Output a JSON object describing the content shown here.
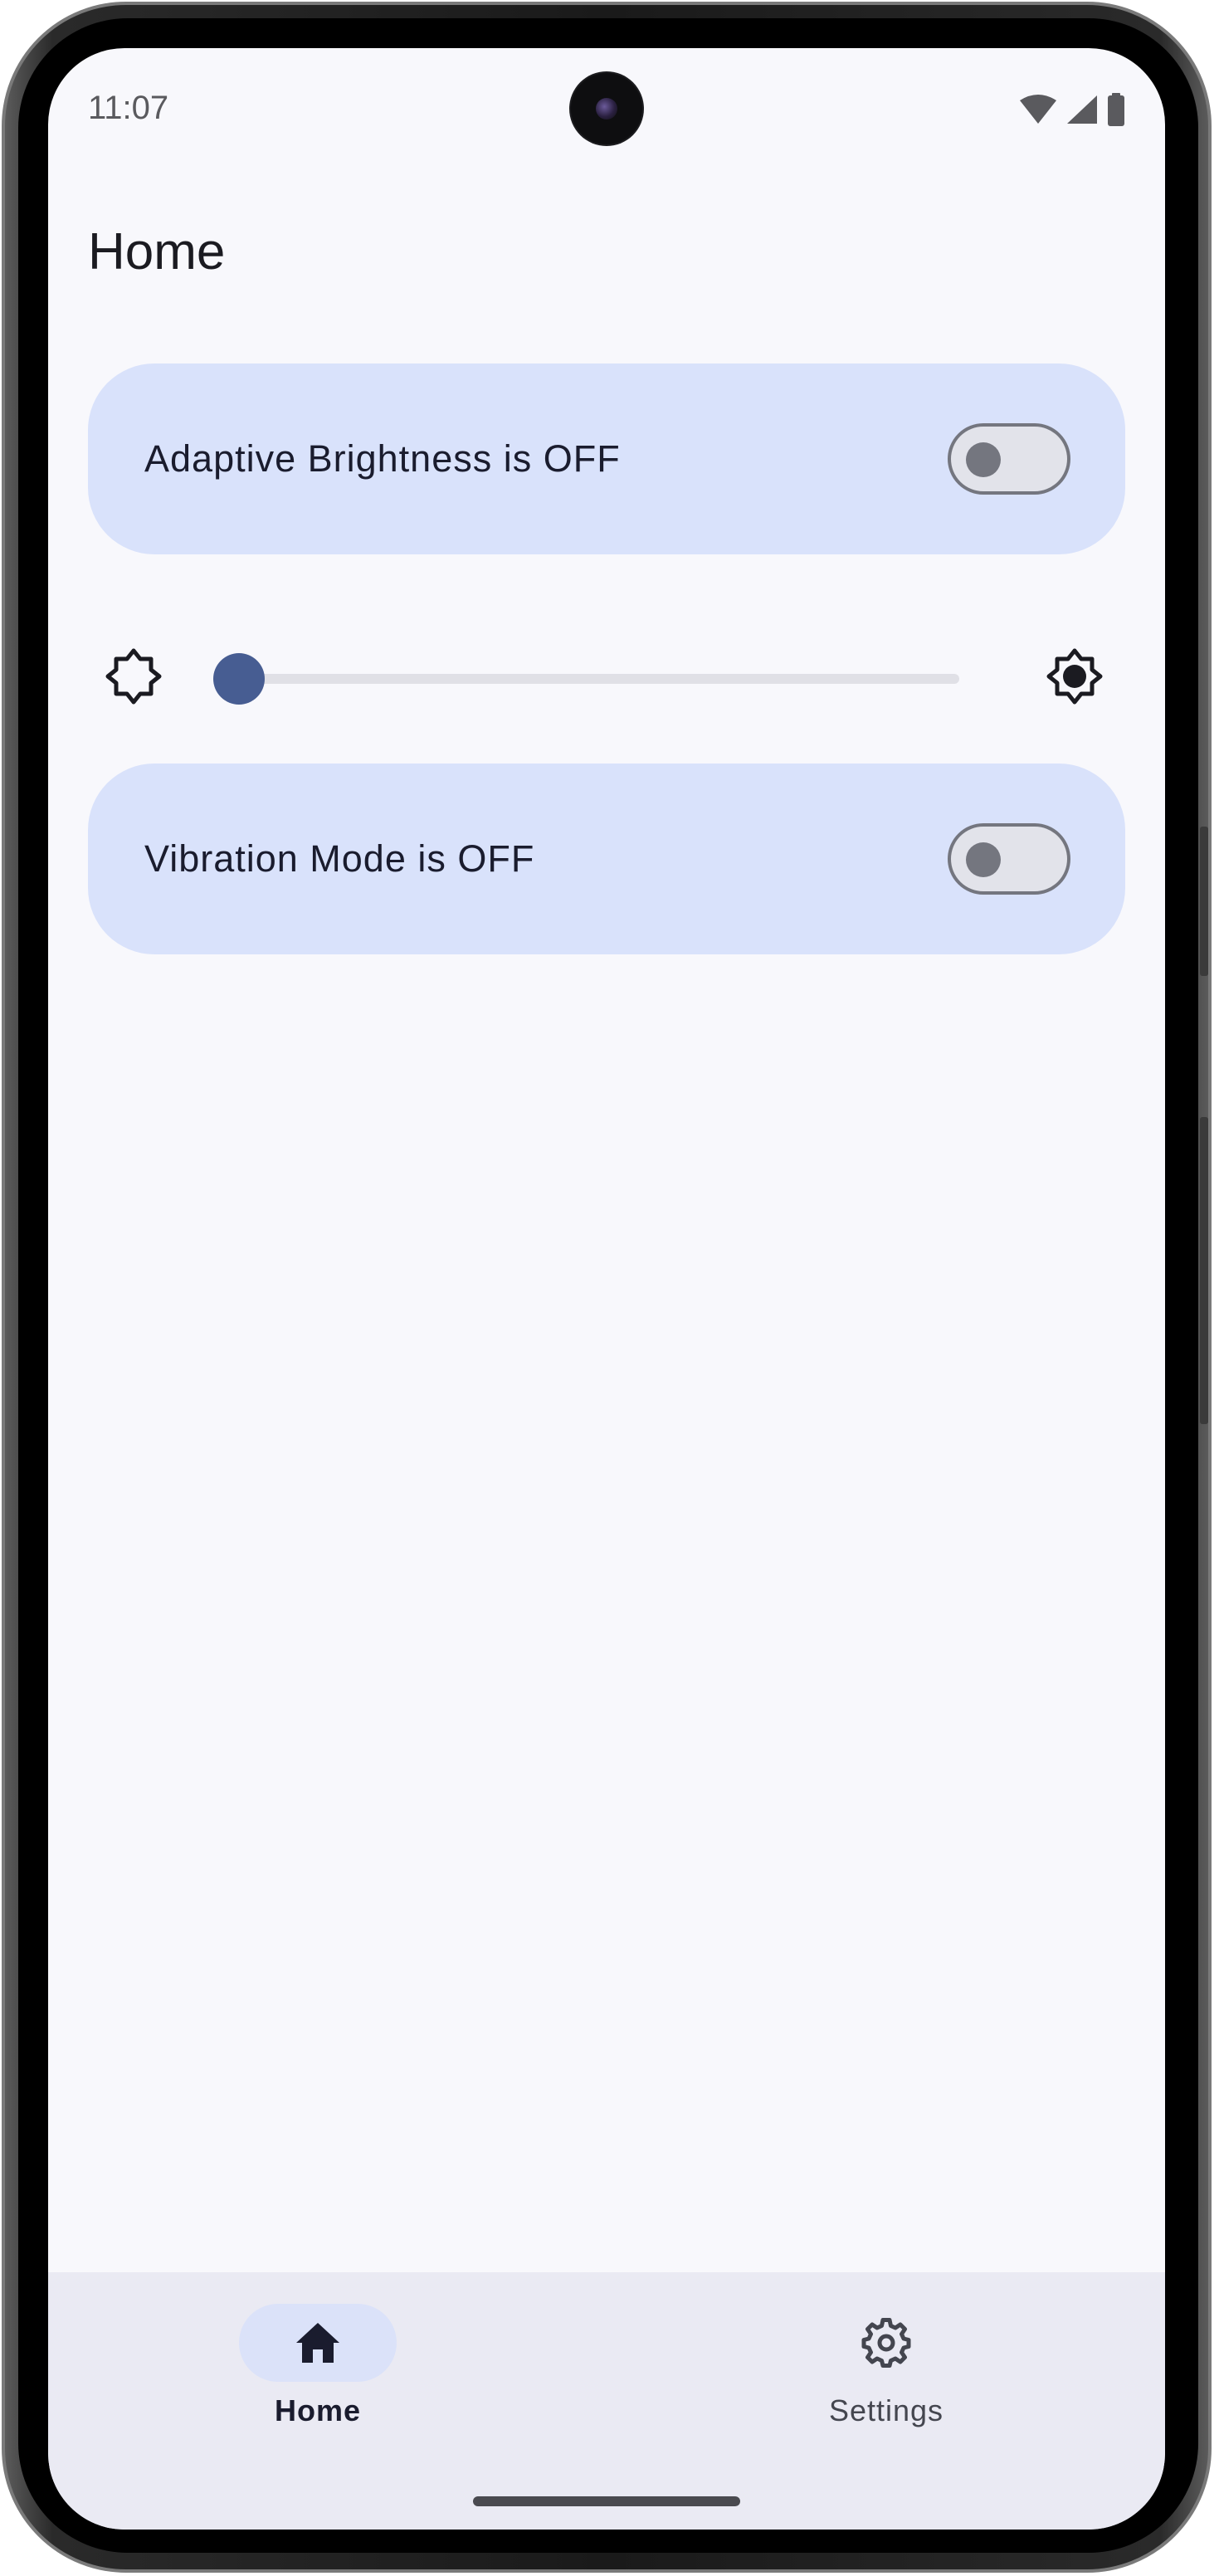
{
  "status_bar": {
    "time": "11:07",
    "icons": [
      "wifi-icon",
      "cellular-signal-icon",
      "battery-icon"
    ]
  },
  "header": {
    "title": "Home"
  },
  "settings": {
    "adaptive_brightness": {
      "label": "Adaptive Brightness is OFF",
      "enabled": false
    },
    "brightness_slider": {
      "value": 0.03,
      "min_icon": "brightness-low-icon",
      "max_icon": "brightness-high-icon"
    },
    "vibration_mode": {
      "label": "Vibration Mode is OFF",
      "enabled": false
    }
  },
  "bottom_nav": {
    "items": [
      {
        "label": "Home",
        "icon": "home-icon",
        "selected": true
      },
      {
        "label": "Settings",
        "icon": "settings-gear-icon",
        "selected": false
      }
    ]
  },
  "colors": {
    "screen_background": "#f8f8fc",
    "card_background": "#d9e2fb",
    "accent": "#475d92",
    "nav_background": "#eaeaf3",
    "nav_selected_pill": "#dbe2f9"
  }
}
